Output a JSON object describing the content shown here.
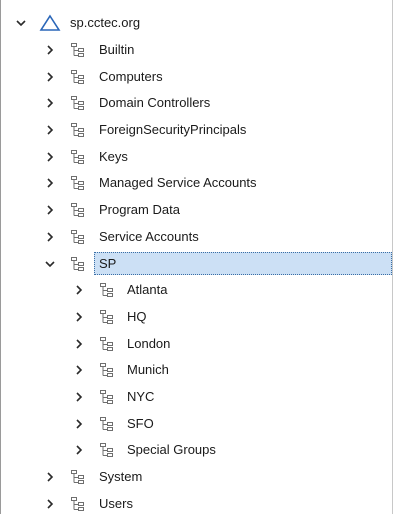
{
  "tree": {
    "root": {
      "label": "sp.cctec.org",
      "icon": "domain-triangle-icon",
      "expanded": true
    },
    "items": [
      {
        "label": "Builtin",
        "expanded": false
      },
      {
        "label": "Computers",
        "expanded": false
      },
      {
        "label": "Domain Controllers",
        "expanded": false
      },
      {
        "label": "ForeignSecurityPrincipals",
        "expanded": false
      },
      {
        "label": "Keys",
        "expanded": false
      },
      {
        "label": "Managed Service Accounts",
        "expanded": false
      },
      {
        "label": "Program Data",
        "expanded": false
      },
      {
        "label": "Service Accounts",
        "expanded": false
      },
      {
        "label": "SP",
        "expanded": true,
        "selected": true,
        "children": [
          {
            "label": "Atlanta",
            "expanded": false
          },
          {
            "label": "HQ",
            "expanded": false
          },
          {
            "label": "London",
            "expanded": false
          },
          {
            "label": "Munich",
            "expanded": false
          },
          {
            "label": "NYC",
            "expanded": false
          },
          {
            "label": "SFO",
            "expanded": false
          },
          {
            "label": "Special Groups",
            "expanded": false
          }
        ]
      },
      {
        "label": "System",
        "expanded": false
      },
      {
        "label": "Users",
        "expanded": false
      }
    ]
  },
  "colors": {
    "selection_fill": "#cce0f5",
    "selection_border": "#3a6ea5",
    "domain_icon": "#2a66b8",
    "ou_icon": "#6f6f6f",
    "text": "#1a1a1a"
  }
}
